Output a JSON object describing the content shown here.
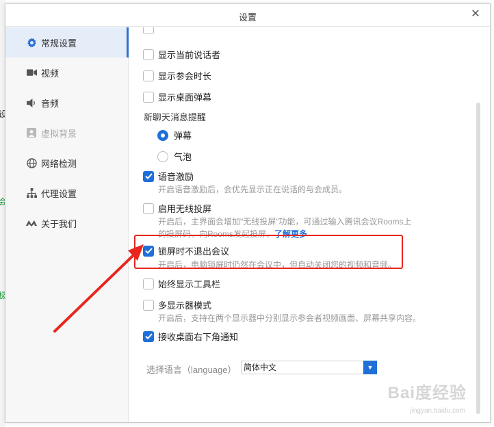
{
  "dialog": {
    "title": "设置",
    "close_glyph": "✕"
  },
  "sidebar": {
    "items": [
      {
        "label": "常规设置",
        "icon": "gear-icon",
        "state": "active"
      },
      {
        "label": "视频",
        "icon": "video-icon",
        "state": "normal"
      },
      {
        "label": "音频",
        "icon": "speaker-icon",
        "state": "normal"
      },
      {
        "label": "虚拟背景",
        "icon": "portrait-icon",
        "state": "disabled"
      },
      {
        "label": "网络检测",
        "icon": "globe-icon",
        "state": "normal"
      },
      {
        "label": "代理设置",
        "icon": "network-icon",
        "state": "normal"
      },
      {
        "label": "关于我们",
        "icon": "logo-icon",
        "state": "normal"
      }
    ]
  },
  "settings": {
    "show_current_speaker": {
      "label": "显示当前说话者",
      "checked": false
    },
    "show_meeting_duration": {
      "label": "显示参会时长",
      "checked": false
    },
    "show_desktop_danmaku": {
      "label": "显示桌面弹幕",
      "checked": false
    },
    "chat_reminder": {
      "label": "新聊天消息提醒",
      "options": [
        {
          "label": "弹幕",
          "selected": true
        },
        {
          "label": "气泡",
          "selected": false
        }
      ]
    },
    "voice_motivation": {
      "label": "语音激励",
      "checked": true,
      "desc": "开启语音激励后，会优先显示正在说话的与会成员。"
    },
    "wireless_projection": {
      "label": "启用无线投屏",
      "checked": false,
      "desc_line1": "开启后，主界面会增加\"无线投屏\"功能，可通过输入腾讯会议Rooms上",
      "desc_line2": "的投屏码，向Rooms发起投屏。",
      "link": "了解更多"
    },
    "stay_on_lock": {
      "label": "锁屏时不退出会议",
      "checked": true,
      "desc": "开启后，电脑锁屏时仍然在会议中，但自动关闭您的视频和音频。"
    },
    "always_toolbar": {
      "label": "始终显示工具栏",
      "checked": false
    },
    "multi_monitor": {
      "label": "多显示器模式",
      "checked": false,
      "desc": "开启后，支持在两个显示器中分别显示参会者视频画面、屏幕共享内容。"
    },
    "desktop_notify": {
      "label": "接收桌面右下角通知",
      "checked": true
    },
    "language": {
      "label": "选择语言（language）",
      "value": "简体中文"
    }
  },
  "background_app": {
    "fragments": [
      "设",
      "会",
      "极"
    ]
  },
  "watermark": {
    "text": "Bai度经验",
    "sub": "jingyan.baidu.com"
  },
  "colors": {
    "accent": "#1f6fd8",
    "annotation": "#e8261e"
  }
}
